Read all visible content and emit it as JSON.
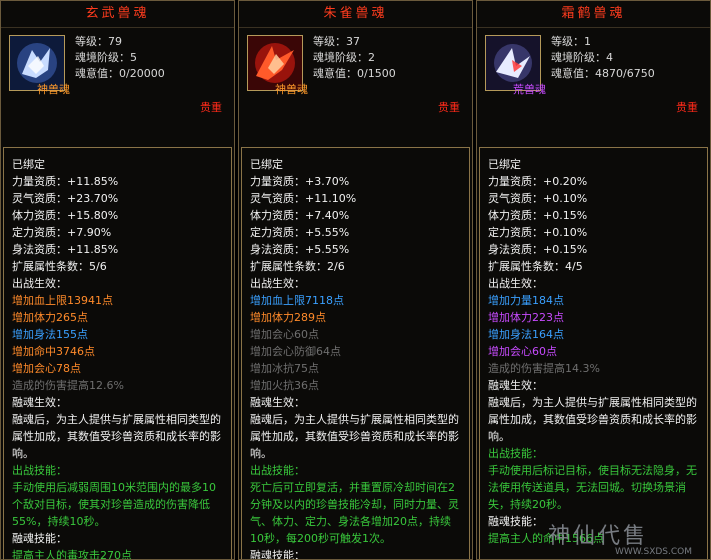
{
  "labels": {
    "level": "等级：",
    "realm": "魂境阶级：",
    "will": "魂意值："
  },
  "panels": [
    {
      "title": "玄武兽魂",
      "icon": "xuanwu-beast-soul-icon",
      "level": "79",
      "realm": "5",
      "will": "0/20000",
      "tier": "神兽魂",
      "tier_color": "#ff9a2a",
      "rarity": "贵重",
      "lines": [
        {
          "text": "已绑定",
          "c": "w"
        },
        {
          "text": "力量资质：+11.85%",
          "c": "w"
        },
        {
          "text": "灵气资质：+23.70%",
          "c": "w"
        },
        {
          "text": "体力资质：+15.80%",
          "c": "w"
        },
        {
          "text": "定力资质：+7.90%",
          "c": "w"
        },
        {
          "text": "身法资质：+11.85%",
          "c": "w"
        },
        {
          "text": "扩展属性条数：5/6",
          "c": "w"
        },
        {
          "text": "出战生效：",
          "c": "w"
        },
        {
          "text": "增加血上限13941点",
          "c": "o"
        },
        {
          "text": "增加体力265点",
          "c": "o"
        },
        {
          "text": "增加身法155点",
          "c": "b"
        },
        {
          "text": "增加命中3746点",
          "c": "o"
        },
        {
          "text": "增加会心78点",
          "c": "o"
        },
        {
          "text": "造成的伤害提高12.6%",
          "c": "g"
        },
        {
          "text": "融魂生效：",
          "c": "w"
        }
      ],
      "fusion_text": "融魂后，为主人提供与扩展属性相同类型的属性加成，其数值受珍兽资质和成长率的影响。",
      "skill_label": "出战技能：",
      "skill_text": "手动使用后减弱周围10米范围内的最多10个敌对目标，使其对珍兽造成的伤害降低55%，持续10秒。",
      "fusion_skill_label": "融魂技能：",
      "fusion_skill_text": "提高主人的毒攻击270点"
    },
    {
      "title": "朱雀兽魂",
      "icon": "zhuque-beast-soul-icon",
      "level": "37",
      "realm": "2",
      "will": "0/1500",
      "tier": "神兽魂",
      "tier_color": "#ff9a2a",
      "rarity": "贵重",
      "lines": [
        {
          "text": "已绑定",
          "c": "w"
        },
        {
          "text": "力量资质：+3.70%",
          "c": "w"
        },
        {
          "text": "灵气资质：+11.10%",
          "c": "w"
        },
        {
          "text": "体力资质：+7.40%",
          "c": "w"
        },
        {
          "text": "定力资质：+5.55%",
          "c": "w"
        },
        {
          "text": "身法资质：+5.55%",
          "c": "w"
        },
        {
          "text": "扩展属性条数：2/6",
          "c": "w"
        },
        {
          "text": "出战生效：",
          "c": "w"
        },
        {
          "text": "增加血上限7118点",
          "c": "b"
        },
        {
          "text": "增加体力289点",
          "c": "o"
        },
        {
          "text": "增加会心60点",
          "c": "g"
        },
        {
          "text": "增加会心防御64点",
          "c": "g"
        },
        {
          "text": "增加冰抗75点",
          "c": "g"
        },
        {
          "text": "增加火抗36点",
          "c": "g"
        },
        {
          "text": "融魂生效：",
          "c": "w"
        }
      ],
      "fusion_text": "融魂后，为主人提供与扩展属性相同类型的属性加成，其数值受珍兽资质和成长率的影响。",
      "skill_label": "出战技能：",
      "skill_text": "死亡后可立即复活，并重置原冷却时间在2分钟及以内的珍兽技能冷却，同时力量、灵气、体力、定力、身法各增加20点，持续10秒，每200秒可触发1次。",
      "fusion_skill_label": "融魂技能：",
      "fusion_skill_text": ""
    },
    {
      "title": "霜鹤兽魂",
      "icon": "shuanghe-beast-soul-icon",
      "level": "1",
      "realm": "4",
      "will": "4870/6750",
      "tier": "荒兽魂",
      "tier_color": "#c84bff",
      "rarity": "贵重",
      "lines": [
        {
          "text": "已绑定",
          "c": "w"
        },
        {
          "text": "力量资质：+0.20%",
          "c": "w"
        },
        {
          "text": "灵气资质：+0.10%",
          "c": "w"
        },
        {
          "text": "体力资质：+0.15%",
          "c": "w"
        },
        {
          "text": "定力资质：+0.10%",
          "c": "w"
        },
        {
          "text": "身法资质：+0.15%",
          "c": "w"
        },
        {
          "text": "扩展属性条数：4/5",
          "c": "w"
        },
        {
          "text": "出战生效：",
          "c": "w"
        },
        {
          "text": "增加力量184点",
          "c": "b"
        },
        {
          "text": "增加体力223点",
          "c": "m"
        },
        {
          "text": "增加身法164点",
          "c": "b"
        },
        {
          "text": "增加会心60点",
          "c": "m"
        },
        {
          "text": "造成的伤害提高14.3%",
          "c": "g"
        },
        {
          "text": "融魂生效：",
          "c": "w"
        }
      ],
      "fusion_text": "融魂后，为主人提供与扩展属性相同类型的属性加成，其数值受珍兽资质和成长率的影响。",
      "skill_label": "出战技能：",
      "skill_text": "手动使用后标记目标，使目标无法隐身，无法使用传送道具，无法回城。切换场景消失，持续20秒。",
      "fusion_skill_label": "融魂技能：",
      "fusion_skill_text": "提高主人的命中1566点"
    }
  ],
  "watermark": {
    "text": "神仙代售",
    "site": "WWW.SXDS.COM"
  }
}
